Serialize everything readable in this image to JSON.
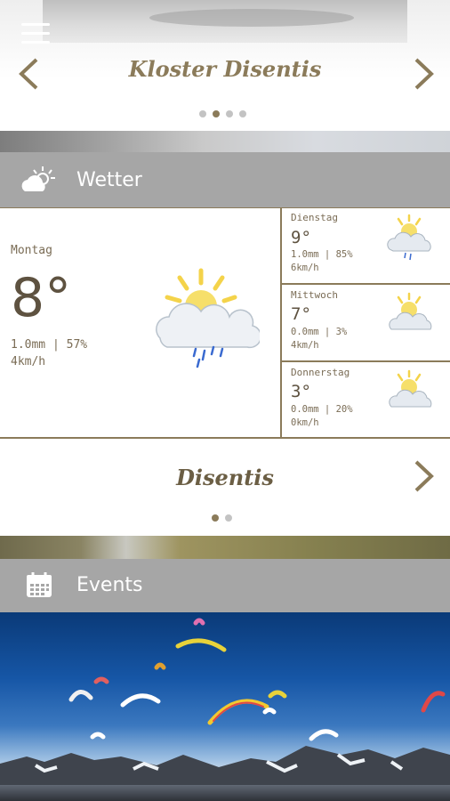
{
  "header": {
    "title": "Kloster Disentis",
    "menu_icon": "hamburger-menu-icon",
    "prev_icon": "chevron-left-icon",
    "next_icon": "chevron-right-icon",
    "pager": {
      "count": 4,
      "active_index": 1
    }
  },
  "weather_section": {
    "label": "Wetter",
    "icon": "weather-sun-cloud-icon"
  },
  "weather": {
    "today": {
      "day": "Montag",
      "temp": "8°",
      "precip": "1.0mm | 57%",
      "wind": "4km/h",
      "icon": "sun-cloud-rain-icon"
    },
    "forecast": [
      {
        "day": "Dienstag",
        "temp": "9°",
        "precip": "1.0mm | 85%",
        "wind": "6km/h",
        "icon": "sun-cloud-rain-icon"
      },
      {
        "day": "Mittwoch",
        "temp": "7°",
        "precip": "0.0mm | 3%",
        "wind": "4km/h",
        "icon": "sun-cloud-icon"
      },
      {
        "day": "Donnerstag",
        "temp": "3°",
        "precip": "0.0mm | 20%",
        "wind": "0km/h",
        "icon": "sun-cloud-icon"
      }
    ]
  },
  "location_card": {
    "title": "Disentis",
    "next_icon": "chevron-right-icon",
    "pager": {
      "count": 2,
      "active_index": 0
    }
  },
  "events_section": {
    "label": "Events",
    "icon": "calendar-icon"
  },
  "colors": {
    "accent": "#8b7b5a",
    "section_bar": "#a6a6a6",
    "text_dark": "#5e5240"
  }
}
